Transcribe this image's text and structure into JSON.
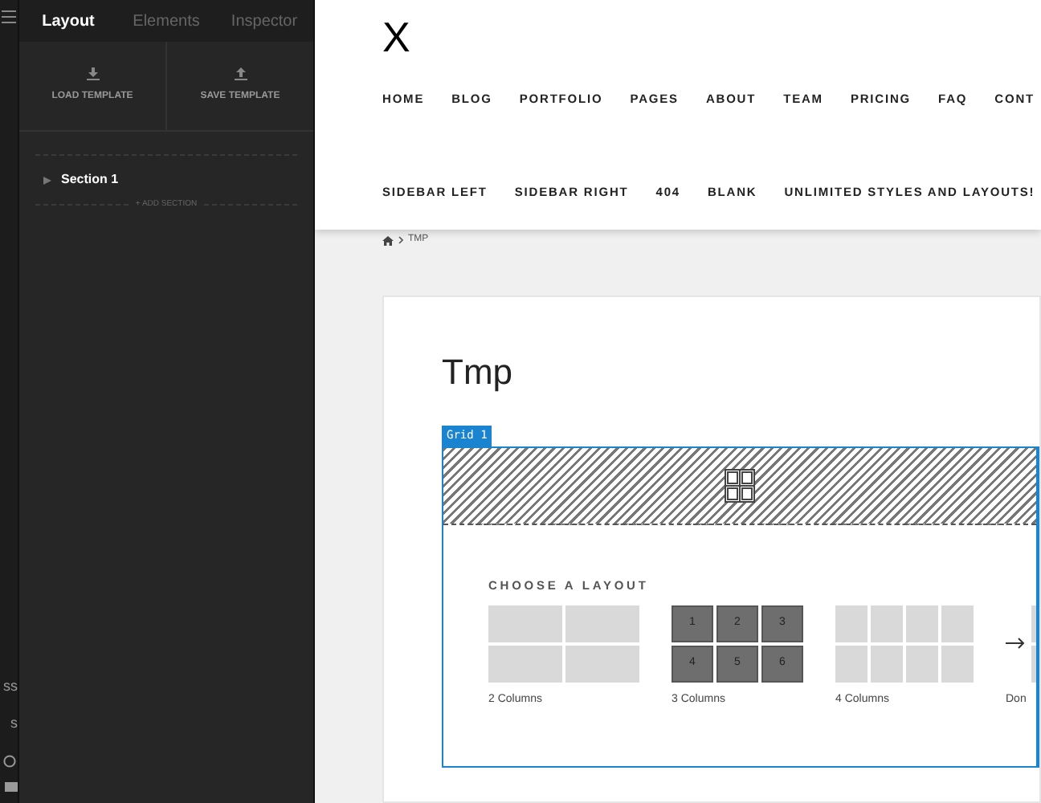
{
  "rail": {
    "items": [
      "ss",
      "s"
    ]
  },
  "sidebar": {
    "tabs": [
      {
        "label": "Layout",
        "selected": true
      },
      {
        "label": "Elements",
        "selected": false
      },
      {
        "label": "Inspector",
        "selected": false
      }
    ],
    "actions": [
      {
        "kind": "load",
        "label": "LOAD TEMPLATE"
      },
      {
        "kind": "save",
        "label": "SAVE TEMPLATE"
      }
    ],
    "sections": [
      {
        "label": "Section 1",
        "expanded": false
      }
    ],
    "add_section": "+ ADD SECTION"
  },
  "site": {
    "logo": "X",
    "nav_rows": [
      [
        "HOME",
        "BLOG",
        "PORTFOLIO",
        "PAGES",
        "ABOUT",
        "TEAM",
        "PRICING",
        "FAQ",
        "CONT"
      ],
      [
        "SIDEBAR LEFT",
        "SIDEBAR RIGHT",
        "404",
        "BLANK",
        "UNLIMITED STYLES AND LAYOUTS!"
      ]
    ],
    "breadcrumb": "TMP",
    "page_title": "Tmp",
    "grid": {
      "tag": "Grid 1",
      "heading": "CHOOSE A LAYOUT",
      "layouts": [
        {
          "kind": "two",
          "label": "2 Columns",
          "selected": false
        },
        {
          "kind": "three",
          "label": "3 Columns",
          "selected": true,
          "cells": [
            "1",
            "2",
            "3",
            "4",
            "5",
            "6"
          ]
        },
        {
          "kind": "four",
          "label": "4 Columns",
          "selected": false
        },
        {
          "kind": "partial",
          "label": "Don",
          "selected": false
        }
      ]
    }
  }
}
